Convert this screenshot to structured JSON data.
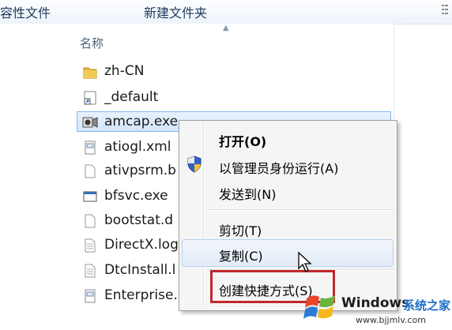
{
  "toolbar": {
    "item_partial": "容性文件",
    "new_folder": "新建文件夹"
  },
  "list": {
    "column_name": "名称",
    "files": [
      {
        "name": "zh-CN",
        "icon": "folder-icon"
      },
      {
        "name": "_default",
        "icon": "shortcut-icon"
      },
      {
        "name": "amcap.exe",
        "icon": "camera-exe-icon"
      },
      {
        "name": "atiogl.xml",
        "icon": "xml-file-icon"
      },
      {
        "name": "ativpsrm.b",
        "icon": "blank-file-icon"
      },
      {
        "name": "bfsvc.exe",
        "icon": "exe-file-icon"
      },
      {
        "name": "bootstat.d",
        "icon": "blank-file-icon"
      },
      {
        "name": "DirectX.log",
        "icon": "text-file-icon"
      },
      {
        "name": "DtcInstall.l",
        "icon": "text-file-icon"
      },
      {
        "name": "Enterprise.",
        "icon": "xml-file-icon"
      }
    ]
  },
  "context_menu": {
    "items": [
      {
        "label": "打开(O)",
        "bold": true
      },
      {
        "label": "以管理员身份运行(A)",
        "icon": "uac-shield-icon"
      },
      {
        "label": "发送到(N)"
      },
      {
        "label": "剪切(T)"
      },
      {
        "label": "复制(C)"
      },
      {
        "label": "创建快捷方式(S)"
      }
    ]
  },
  "watermark": {
    "title": "Windows",
    "subtitle": "系统之家",
    "url": "www.bjjmlv.com"
  },
  "colors": {
    "selection_border": "#86b8ed",
    "highlight_box": "#c0282c",
    "folder_yellow": "#e8b63c"
  }
}
